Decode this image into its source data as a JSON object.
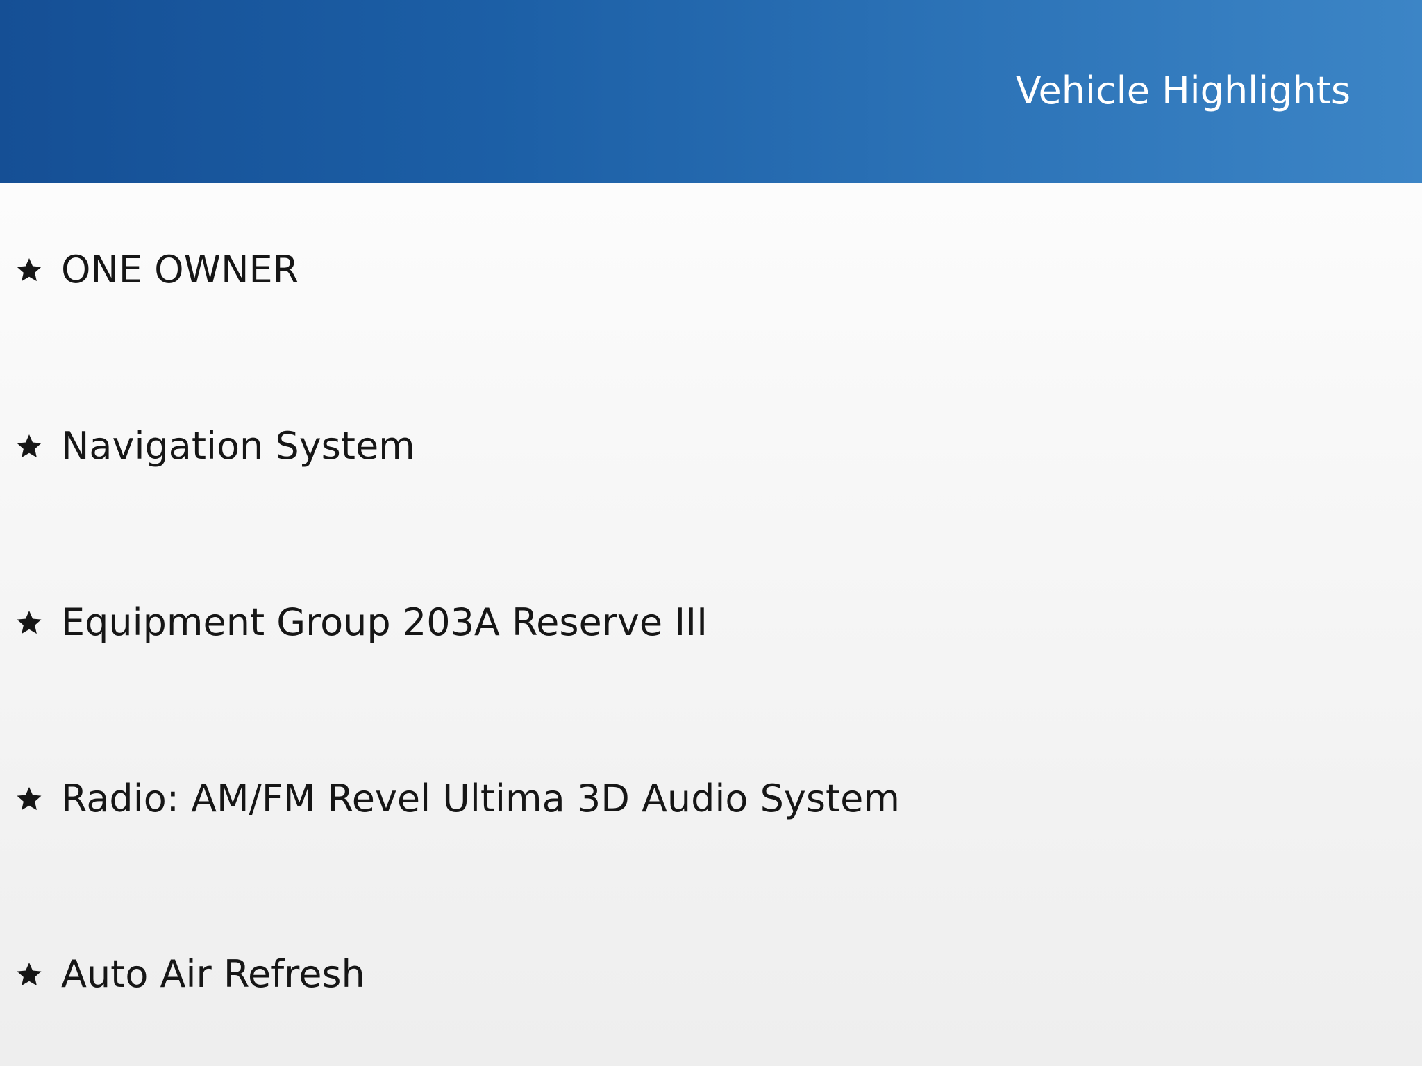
{
  "header": {
    "title": "Vehicle Highlights"
  },
  "highlights": {
    "bullet_icon": "star-icon",
    "items": [
      {
        "label": "ONE OWNER"
      },
      {
        "label": "Navigation System"
      },
      {
        "label": "Equipment Group 203A Reserve III"
      },
      {
        "label": "Radio: AM/FM Revel Ultima 3D Audio System"
      },
      {
        "label": "Auto Air Refresh"
      }
    ]
  },
  "colors": {
    "header_gradient_start": "#154f95",
    "header_gradient_end": "#3c85c6",
    "header_text": "#ffffff",
    "item_text": "#161616",
    "background_top": "#ffffff",
    "background_bottom": "#eeeeee"
  }
}
